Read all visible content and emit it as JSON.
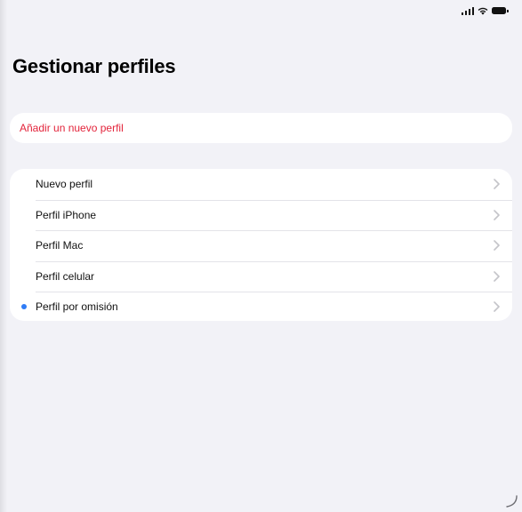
{
  "status_bar": {
    "icons": [
      "signal-icon",
      "wifi-icon",
      "battery-icon"
    ]
  },
  "page": {
    "title": "Gestionar perfiles"
  },
  "actions": {
    "add_profile_label": "Añadir un nuevo perfil",
    "accent_color": "#e3243b"
  },
  "profiles": [
    {
      "label": "Nuevo perfil",
      "selected": false
    },
    {
      "label": "Perfil iPhone",
      "selected": false
    },
    {
      "label": "Perfil Mac",
      "selected": false
    },
    {
      "label": "Perfil celular",
      "selected": false
    },
    {
      "label": "Perfil por omisión",
      "selected": true
    }
  ],
  "colors": {
    "background": "#f2f2f7",
    "selected_dot": "#2f7cf6",
    "chevron": "#c4c4c9"
  }
}
